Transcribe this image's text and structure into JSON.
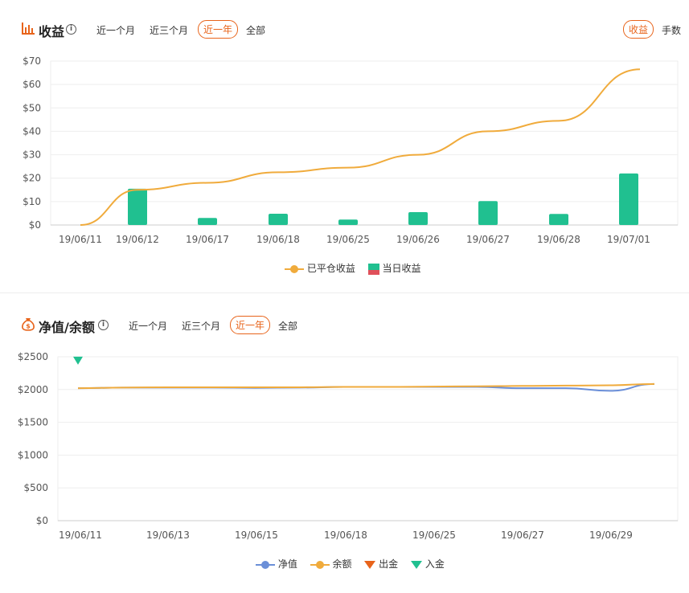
{
  "panel1": {
    "title": "收益",
    "info": "i",
    "tabs": [
      "近一个月",
      "近三个月",
      "近一年",
      "全部"
    ],
    "active_tab": 2,
    "right_tabs": [
      "收益",
      "手数"
    ],
    "right_active": 0
  },
  "panel2": {
    "title": "净值/余额",
    "info": "i",
    "tabs": [
      "近一个月",
      "近三个月",
      "近一年",
      "全部"
    ],
    "active_tab": 2
  },
  "colors": {
    "accent": "#e8641b",
    "line": "#f0ab3c",
    "bar": "#20c090",
    "bar_neg": "#e0505a",
    "net": "#6b8fd8",
    "withdraw": "#e8641b",
    "deposit": "#20c090",
    "grid": "#eeeeee"
  },
  "chart_data": [
    {
      "type": "bar",
      "categories": [
        "19/06/11",
        "19/06/12",
        "19/06/17",
        "19/06/18",
        "19/06/25",
        "19/06/26",
        "19/06/27",
        "19/06/28",
        "19/07/01"
      ],
      "series": [
        {
          "name": "已平仓收益",
          "kind": "line",
          "values": [
            0,
            15,
            18,
            22.5,
            24.5,
            30,
            40,
            44.5,
            66.5
          ]
        },
        {
          "name": "当日收益",
          "kind": "bar",
          "values": [
            0,
            15.5,
            3,
            4.8,
            2.3,
            5.5,
            10.2,
            4.7,
            22
          ]
        }
      ],
      "yticks": [
        "$0",
        "$10",
        "$20",
        "$30",
        "$40",
        "$50",
        "$60",
        "$70"
      ],
      "ylim": [
        0,
        70
      ],
      "legend": "bottom"
    },
    {
      "type": "line",
      "x_ticks": [
        "19/06/11",
        "19/06/13",
        "19/06/15",
        "19/06/18",
        "19/06/25",
        "19/06/27",
        "19/06/29"
      ],
      "series": [
        {
          "name": "净值",
          "values": [
            2020,
            2030,
            2030,
            2030,
            2025,
            2030,
            2040,
            2040,
            2040,
            2040,
            2020,
            2020,
            1980,
            2085
          ]
        },
        {
          "name": "余额",
          "values": [
            2020,
            2030,
            2035,
            2035,
            2035,
            2035,
            2040,
            2040,
            2045,
            2050,
            2055,
            2060,
            2065,
            2085
          ]
        },
        {
          "name": "出金",
          "values": []
        },
        {
          "name": "入金",
          "values": [
            2440
          ]
        }
      ],
      "yticks": [
        "$0",
        "$500",
        "$1000",
        "$1500",
        "$2000",
        "$2500"
      ],
      "ylim": [
        0,
        2500
      ],
      "legend": "bottom"
    }
  ]
}
